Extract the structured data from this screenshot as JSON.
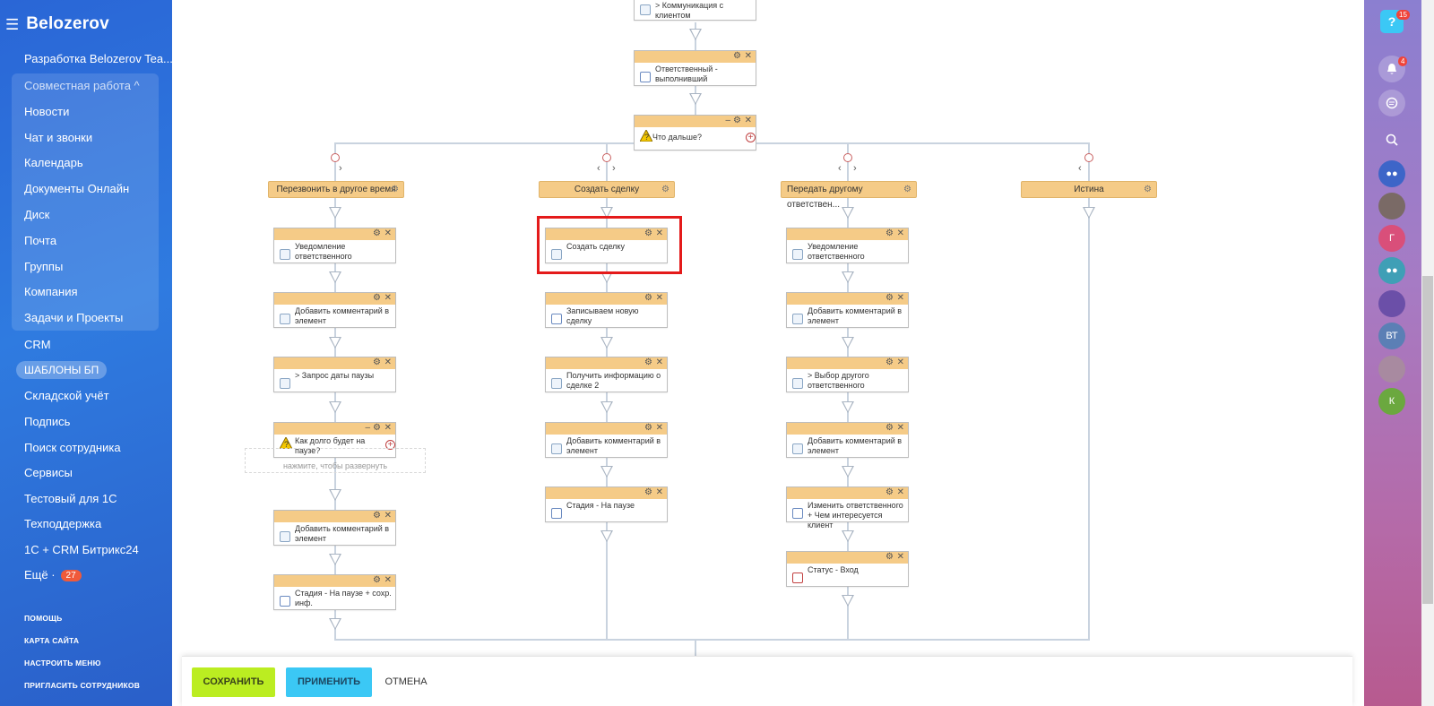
{
  "sidebar": {
    "logo": "Belozerov",
    "items": [
      {
        "label": "Разработка Belozerov Tea..."
      },
      {
        "label": "Совместная работа ^"
      },
      {
        "label": "Новости"
      },
      {
        "label": "Чат и звонки"
      },
      {
        "label": "Календарь"
      },
      {
        "label": "Документы Онлайн"
      },
      {
        "label": "Диск"
      },
      {
        "label": "Почта"
      },
      {
        "label": "Группы"
      },
      {
        "label": "Компания"
      },
      {
        "label": "Задачи и Проекты"
      },
      {
        "label": "CRM"
      },
      {
        "label": "ШАБЛОНЫ БП"
      },
      {
        "label": "Складской учёт"
      },
      {
        "label": "Подпись"
      },
      {
        "label": "Поиск сотрудника"
      },
      {
        "label": "Сервисы"
      },
      {
        "label": "Тестовый для 1С"
      },
      {
        "label": "Техподдержка"
      },
      {
        "label": "1С + CRM Битрикс24"
      },
      {
        "label": "Ещё ·",
        "badge": "27"
      }
    ],
    "links": [
      "ПОМОЩЬ",
      "КАРТА САЙТА",
      "НАСТРОИТЬ МЕНЮ",
      "ПРИГЛАСИТЬ СОТРУДНИКОВ"
    ]
  },
  "rightbar": {
    "help_badge": "15",
    "notif_badge": "4",
    "avatars": [
      "Г",
      "ВТ",
      "К"
    ]
  },
  "workflow": {
    "top": [
      {
        "title": "> Коммуникация с клиентом"
      },
      {
        "title": "Ответственный - выполнивший"
      },
      {
        "title": "Что дальше?"
      }
    ],
    "branches": [
      {
        "label": "Перезвонить в другое время",
        "actions": [
          "Уведомление ответственного",
          "Добавить комментарий в элемент",
          "> Запрос даты паузы",
          "Как долго будет на паузе?",
          "Добавить комментарий в элемент",
          "Стадия - На паузе + сохр. инф."
        ],
        "hint": "нажмите, чтобы развернуть"
      },
      {
        "label": "Создать сделку",
        "actions": [
          "Создать сделку",
          "Записываем новую сделку",
          "Получить информацию о сделке 2",
          "Добавить комментарий в элемент",
          "Стадия - На паузе"
        ]
      },
      {
        "label": "Передать другому ответствен...",
        "actions": [
          "Уведомление ответственного",
          "Добавить комментарий в элемент",
          "> Выбор другого ответственного",
          "Добавить комментарий в элемент",
          "Изменить ответственного + Чем интересуется клиент",
          "Статус - Вход"
        ]
      },
      {
        "label": "Истина",
        "actions": []
      }
    ]
  },
  "footer": {
    "save": "СОХРАНИТЬ",
    "apply": "ПРИМЕНИТЬ",
    "cancel": "ОТМЕНА"
  }
}
